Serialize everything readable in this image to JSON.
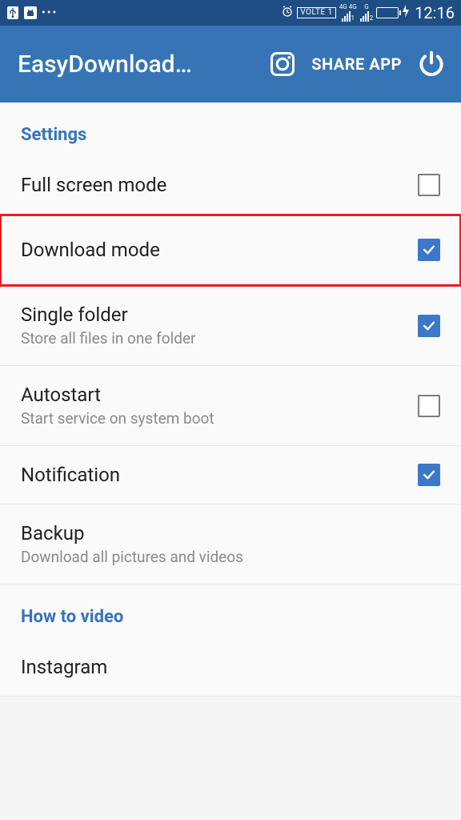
{
  "status": {
    "volte": "VOLTE 1",
    "net1_label": "4G 4G",
    "sim1_sub": "1",
    "net2_label": "G",
    "sim2_sub": "2",
    "time": "12:16"
  },
  "appbar": {
    "title": "EasyDownload…",
    "share_label": "SHARE APP"
  },
  "sections": {
    "settings_header": "Settings",
    "howto_header": "How to video"
  },
  "rows": {
    "full_screen": {
      "title": "Full screen mode",
      "checked": false
    },
    "download_mode": {
      "title": "Download mode",
      "checked": true
    },
    "single_folder": {
      "title": "Single folder",
      "subtitle": "Store all files in one folder",
      "checked": true
    },
    "autostart": {
      "title": "Autostart",
      "subtitle": "Start service on system boot",
      "checked": false
    },
    "notification": {
      "title": "Notification",
      "checked": true
    },
    "backup": {
      "title": "Backup",
      "subtitle": "Download all pictures and videos"
    },
    "instagram": {
      "title": "Instagram"
    }
  }
}
